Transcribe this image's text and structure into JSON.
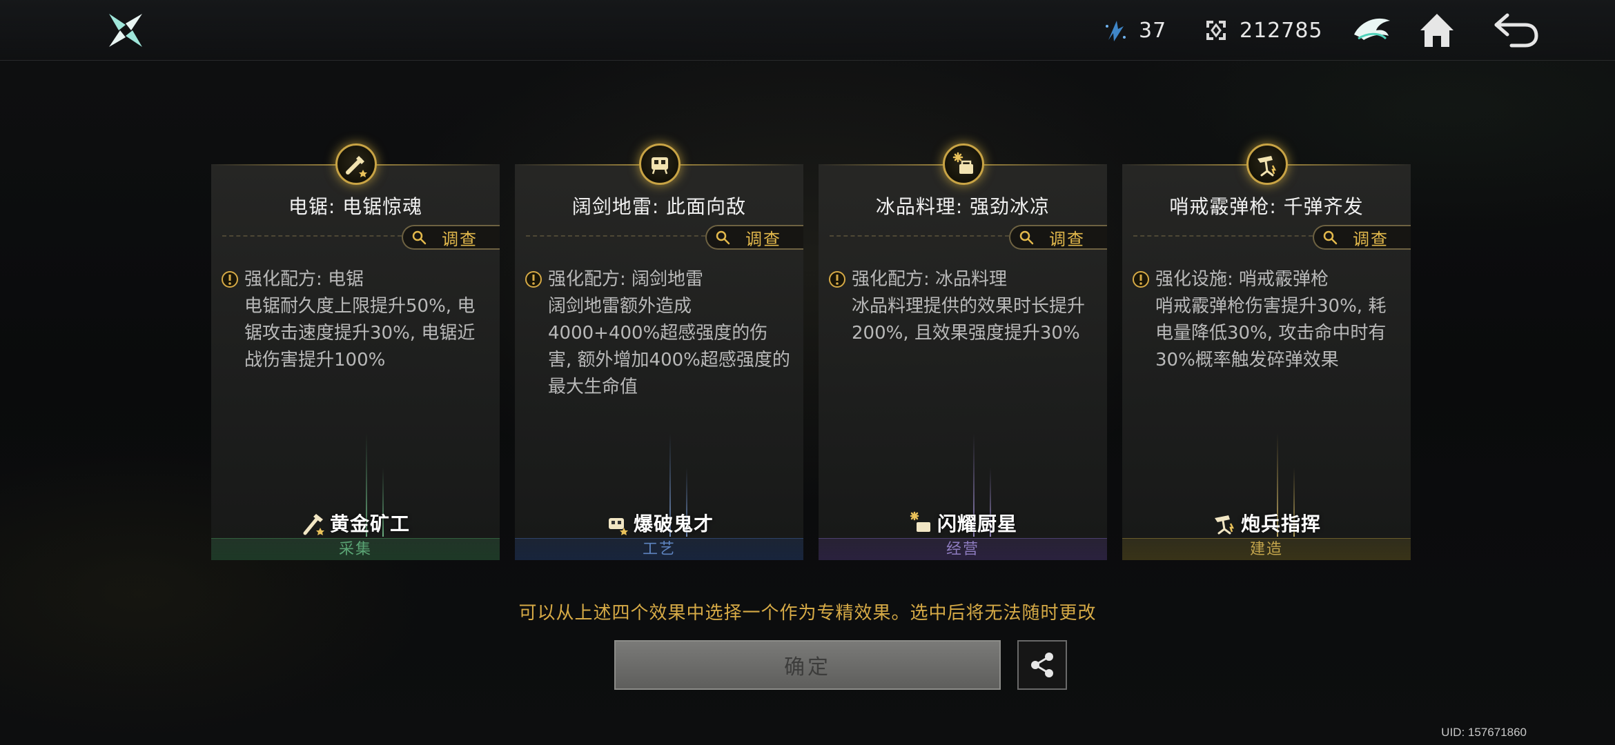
{
  "header": {
    "logo_icon": "shuriken-logo-icon",
    "resources": [
      {
        "icon": "energy-crystal-icon",
        "value": "37"
      },
      {
        "icon": "currency-token-icon",
        "value": "212785"
      }
    ],
    "buttons": [
      "guild-emblem-icon",
      "home-icon",
      "back-icon"
    ]
  },
  "cards": [
    {
      "title": "电锯: 电锯惊魂",
      "investigate_label": "调查",
      "body_line1": "强化配方: 电锯",
      "body_text": "电锯耐久度上限提升50%, 电锯攻击速度提升30%, 电锯近战伤害提升100%",
      "role_name": "黄金矿工",
      "category": "采集",
      "accent": "#5aa474"
    },
    {
      "title": "阔剑地雷: 此面向敌",
      "investigate_label": "调查",
      "body_line1": "强化配方: 阔剑地雷",
      "body_text": "阔剑地雷额外造成4000+400%超感强度的伤害, 额外增加400%超感强度的最大生命值",
      "role_name": "爆破鬼才",
      "category": "工艺",
      "accent": "#5e84c0"
    },
    {
      "title": "冰品料理: 强劲冰凉",
      "investigate_label": "调查",
      "body_line1": "强化配方: 冰品料理",
      "body_text": "冰品料理提供的效果时长提升200%, 且效果强度提升30%",
      "role_name": "闪耀厨星",
      "category": "经营",
      "accent": "#8e7cc0"
    },
    {
      "title": "哨戒霰弹枪: 千弹齐发",
      "investigate_label": "调查",
      "body_line1": "强化设施: 哨戒霰弹枪",
      "body_text": "哨戒霰弹枪伤害提升30%, 耗电量降低30%, 攻击命中时有30%概率触发碎弹效果",
      "role_name": "炮兵指挥",
      "category": "建造",
      "accent": "#c4a54c"
    }
  ],
  "hint": "可以从上述四个效果中选择一个作为专精效果。选中后将无法随时更改",
  "confirm_label": "确定",
  "uid": "UID: 157671860",
  "colors": {
    "gold": "#d6aa46",
    "bg": "#0b0c0d"
  }
}
